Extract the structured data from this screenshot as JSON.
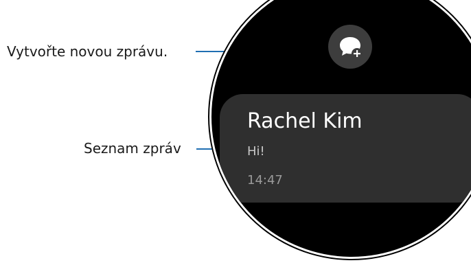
{
  "callouts": {
    "new_message": "Vytvořte novou zprávu.",
    "message_list": "Seznam zpráv"
  },
  "watch": {
    "new_message_button": {
      "icon": "new-message-icon"
    },
    "message": {
      "contact_name": "Rachel Kim",
      "preview": "Hi!",
      "time": "14:47"
    }
  },
  "colors": {
    "callout_line": "#1f6fb2",
    "watch_background": "#000000",
    "card_background": "#2f2f2f",
    "button_background": "#3d3d3d"
  }
}
